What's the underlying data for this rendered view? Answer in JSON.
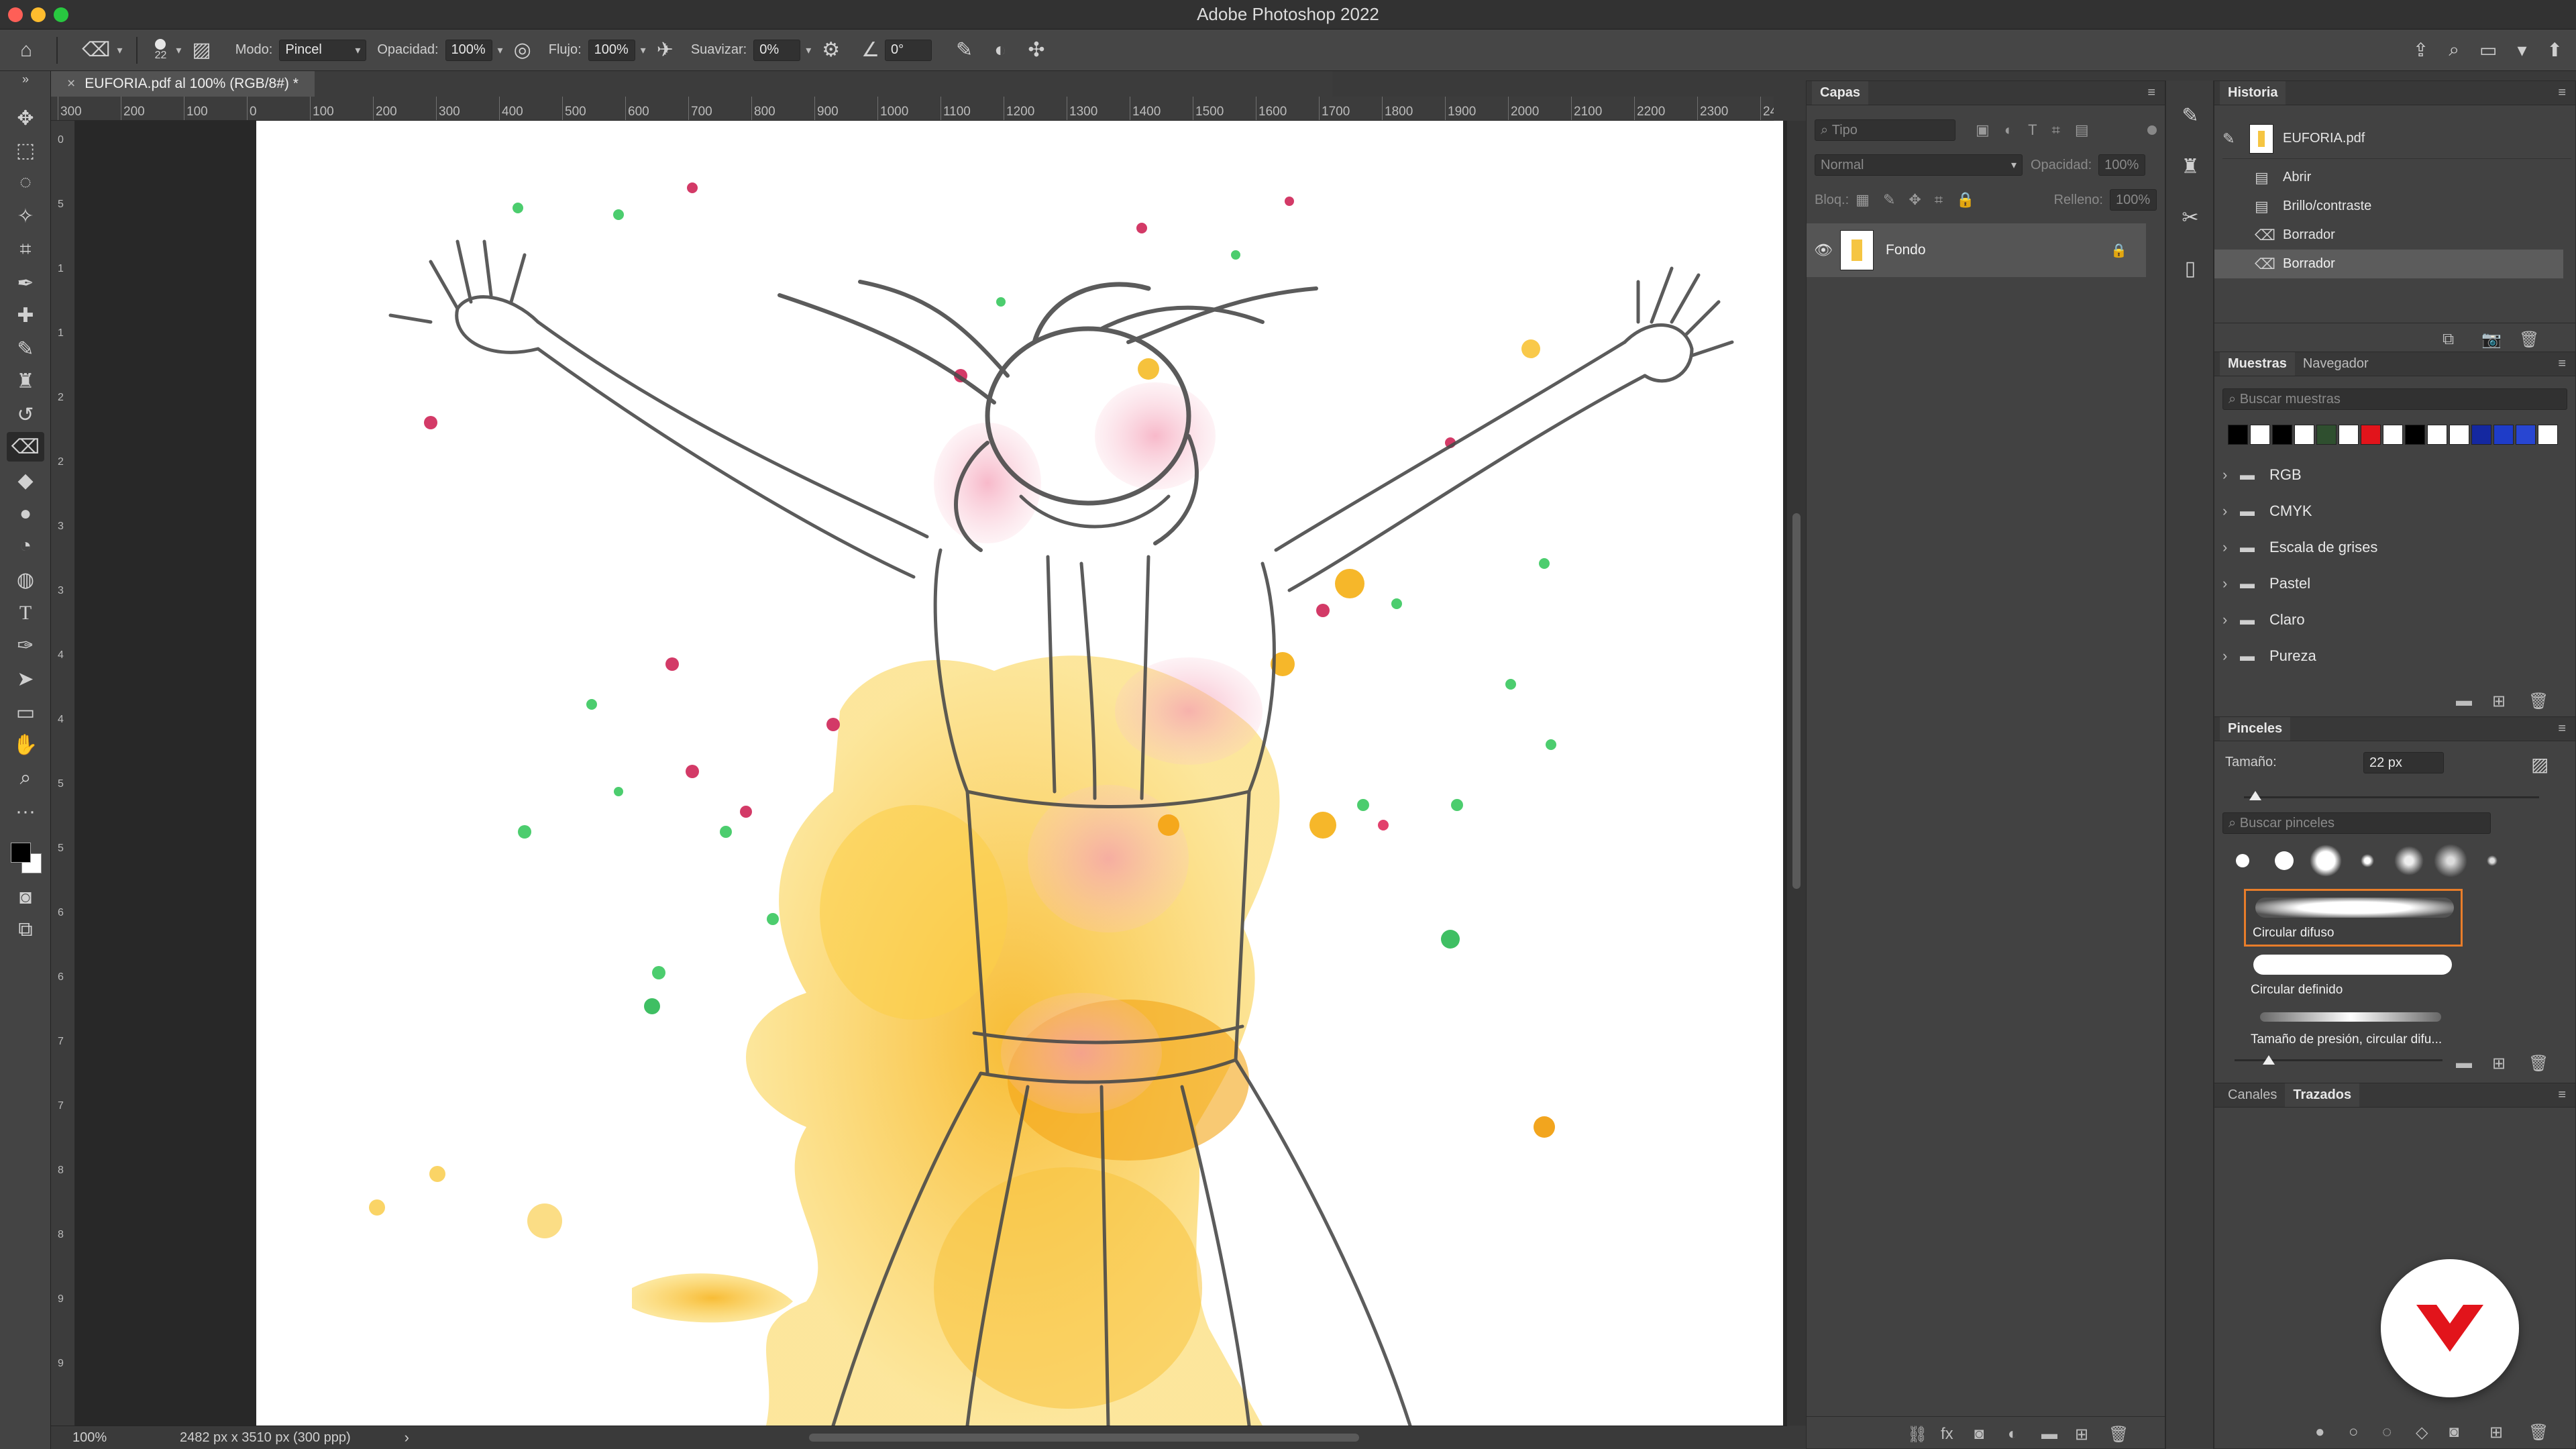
{
  "window": {
    "title": "Adobe Photoshop 2022"
  },
  "options_bar": {
    "brush_size": "22",
    "mode_label": "Modo:",
    "mode_value": "Pincel",
    "opacity_label": "Opacidad:",
    "opacity_value": "100%",
    "flow_label": "Flujo:",
    "flow_value": "100%",
    "smooth_label": "Suavizar:",
    "smooth_value": "0%",
    "angle_value": "0°"
  },
  "document": {
    "tab_title": "EUFORIA.pdf al 100% (RGB/8#) *",
    "zoom": "100%",
    "dimensions": "2482 px x 3510 px (300 ppp)"
  },
  "ruler": {
    "top_ticks": [
      "300",
      "200",
      "100",
      "0",
      "100",
      "200",
      "300",
      "400",
      "500",
      "600",
      "700",
      "800",
      "900",
      "1000",
      "1100",
      "1200",
      "1300",
      "1400",
      "1500",
      "1600",
      "1700",
      "1800",
      "1900",
      "2000",
      "2100",
      "2200",
      "2300",
      "24"
    ],
    "left_ticks": [
      "0",
      "5",
      "1",
      "1",
      "2",
      "2",
      "3",
      "3",
      "4",
      "4",
      "5",
      "5",
      "6",
      "6",
      "7",
      "7",
      "8",
      "8",
      "9",
      "9"
    ]
  },
  "layers_panel": {
    "tab": "Capas",
    "filter_placeholder": "Tipo",
    "blend_mode": "Normal",
    "opacity_label": "Opacidad:",
    "opacity_value": "100%",
    "lock_label": "Bloq.:",
    "fill_label": "Relleno:",
    "fill_value": "100%",
    "layers": [
      {
        "name": "Fondo"
      }
    ]
  },
  "history_panel": {
    "tab": "Historia",
    "snapshot": "EUFORIA.pdf",
    "items": [
      {
        "label": "Abrir"
      },
      {
        "label": "Brillo/contraste"
      },
      {
        "label": "Borrador"
      },
      {
        "label": "Borrador"
      }
    ]
  },
  "swatches_panel": {
    "tabs": [
      "Muestras",
      "Navegador"
    ],
    "search_placeholder": "Buscar muestras",
    "colors": [
      "#000000",
      "#ffffff",
      "#000000",
      "#ffffff",
      "#2f4f2f",
      "#ffffff",
      "#e2141b",
      "#ffffff",
      "#000000",
      "#ffffff",
      "#ffffff",
      "#1428a0",
      "#1e3cc8",
      "#2846d2",
      "#ffffff"
    ],
    "folders": [
      {
        "label": "RGB"
      },
      {
        "label": "CMYK"
      },
      {
        "label": "Escala de grises"
      },
      {
        "label": "Pastel"
      },
      {
        "label": "Claro"
      },
      {
        "label": "Pureza"
      }
    ]
  },
  "brushes_panel": {
    "tab": "Pinceles",
    "size_label": "Tamaño:",
    "size_value": "22 px",
    "search_placeholder": "Buscar pinceles",
    "brushes": [
      {
        "label": "Circular difuso"
      },
      {
        "label": "Circular definido"
      },
      {
        "label": "Tamaño de presión, circular difu..."
      }
    ]
  },
  "channels_panel": {
    "tabs": [
      "Canales",
      "Trazados"
    ]
  },
  "colors": {
    "accent": "#e87d2a",
    "logo_red": "#e2141b"
  }
}
